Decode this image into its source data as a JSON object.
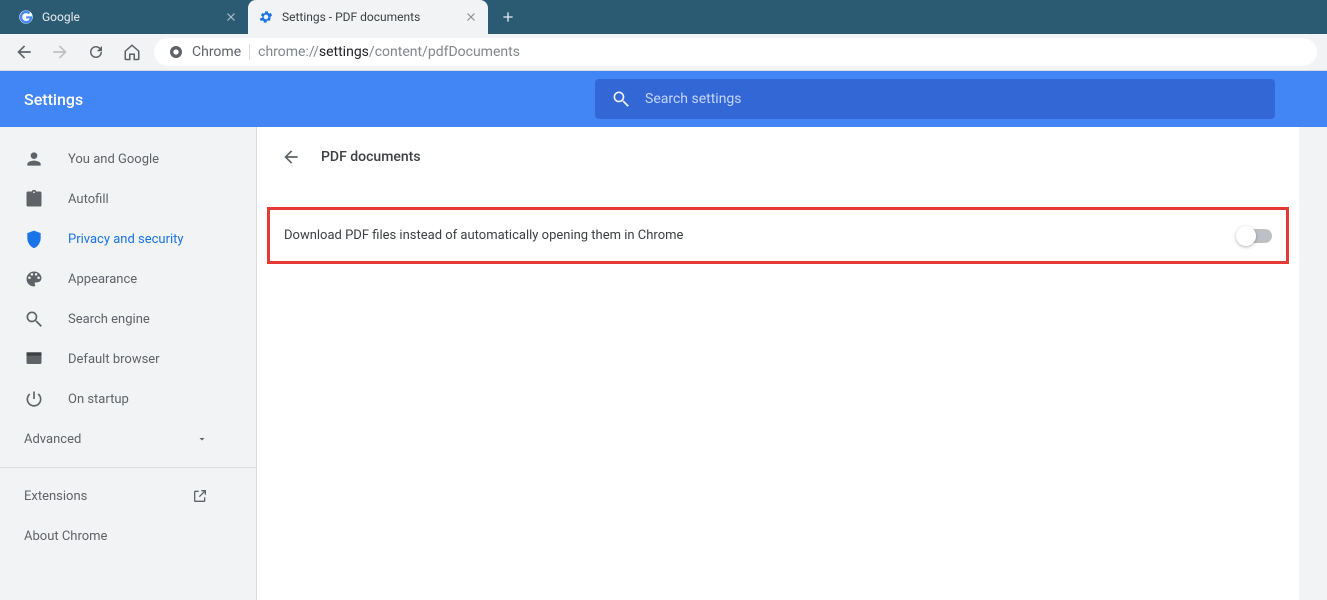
{
  "tabs": [
    {
      "title": "Google",
      "active": false
    },
    {
      "title": "Settings - PDF documents",
      "active": true
    }
  ],
  "omnibox": {
    "site_label": "Chrome",
    "url_prefix": "chrome://",
    "url_bold": "settings",
    "url_suffix": "/content/pdfDocuments"
  },
  "settings_header": {
    "title": "Settings",
    "search_placeholder": "Search settings"
  },
  "sidebar": {
    "items": [
      {
        "label": "You and Google"
      },
      {
        "label": "Autofill"
      },
      {
        "label": "Privacy and security"
      },
      {
        "label": "Appearance"
      },
      {
        "label": "Search engine"
      },
      {
        "label": "Default browser"
      },
      {
        "label": "On startup"
      }
    ],
    "advanced": "Advanced",
    "extensions": "Extensions",
    "about": "About Chrome"
  },
  "main": {
    "page_title": "PDF documents",
    "option_label": "Download PDF files instead of automatically opening them in Chrome",
    "toggle_on": false
  }
}
